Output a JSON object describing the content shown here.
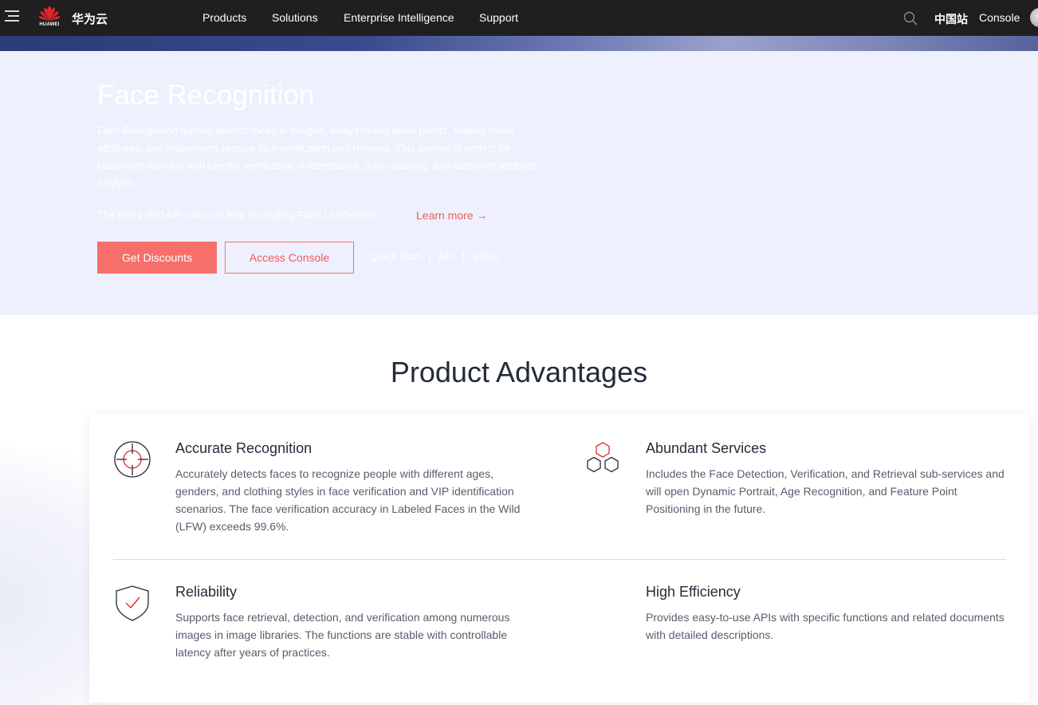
{
  "nav": {
    "brand": "华为云",
    "logo_text": "HUAWEI",
    "items": [
      "Products",
      "Solutions",
      "Enterprise Intelligence",
      "Support"
    ],
    "site_switch": "中国站",
    "console": "Console"
  },
  "hero": {
    "title": "Face Recognition",
    "description": "Face Recognition quickly detects faces in images, analyzes key facial points, obtains facial attributes, and implements precise face verification and retrieval. This service is perfect for customers working with identity verification, e-attendance, trace tracking, and customer attribute analysis.",
    "free_note": "The first 2,000 API calls are free (excluding Face LiveDetect).",
    "learn_more": "Learn more →",
    "btn_discounts": "Get Discounts",
    "btn_console": "Access Console",
    "quick_links": [
      "Quick Start",
      "API",
      "SDKs"
    ],
    "separator": "|"
  },
  "advantages": {
    "title": "Product Advantages",
    "items": [
      {
        "title": "Accurate Recognition",
        "text": "Accurately detects faces to recognize people with different ages, genders, and clothing styles in face verification and VIP identification scenarios. The face verification accuracy in Labeled Faces in the Wild (LFW) exceeds 99.6%.",
        "icon": "target-icon"
      },
      {
        "title": "Abundant Services",
        "text": "Includes the Face Detection, Verification, and Retrieval sub-services and will open Dynamic Portrait, Age Recognition, and Feature Point Positioning in the future.",
        "icon": "hexagons-icon"
      },
      {
        "title": "Reliability",
        "text": "Supports face retrieval, detection, and verification among numerous images in image libraries. The functions are stable with controllable latency after years of practices.",
        "icon": "shield-check-icon"
      },
      {
        "title": "High Efficiency",
        "text": "Provides easy-to-use APIs with specific functions and related documents with detailed descriptions.",
        "icon": "none"
      }
    ]
  },
  "colors": {
    "nav_bg": "#1f1f1f",
    "hero_bg": "#eef0fd",
    "accent": "#f66f6a",
    "accent_text": "#ef5d5a",
    "text_dark": "#252b3a",
    "text_body": "#575d6c"
  }
}
